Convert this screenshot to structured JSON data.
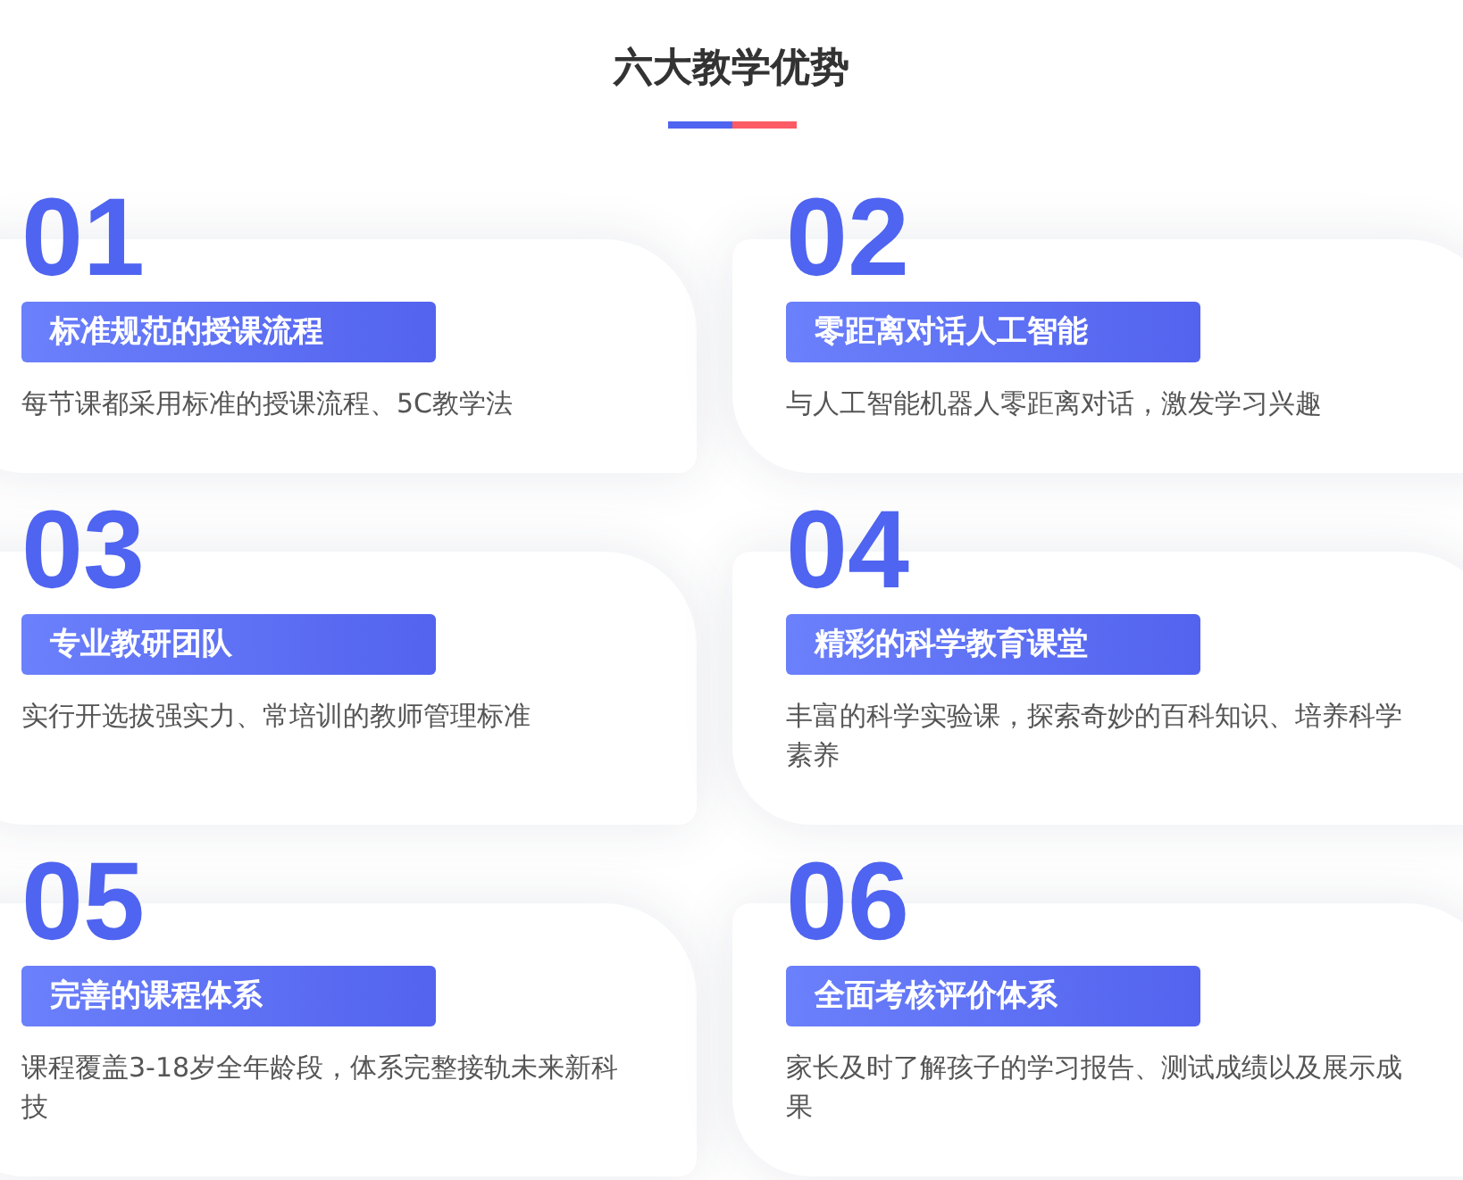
{
  "title": "六大教学优势",
  "features": [
    {
      "number": "01",
      "heading": "标准规范的授课流程",
      "description": "每节课都采用标准的授课流程、5C教学法"
    },
    {
      "number": "02",
      "heading": "零距离对话人工智能",
      "description": "与人工智能机器人零距离对话，激发学习兴趣"
    },
    {
      "number": "03",
      "heading": "专业教研团队",
      "description": "实行开选拔强实力、常培训的教师管理标准"
    },
    {
      "number": "04",
      "heading": "精彩的科学教育课堂",
      "description": "丰富的科学实验课，探索奇妙的百科知识、培养科学素养"
    },
    {
      "number": "05",
      "heading": "完善的课程体系",
      "description": "课程覆盖3-18岁全年龄段，体系完整接轨未来新科技"
    },
    {
      "number": "06",
      "heading": "全面考核评价体系",
      "description": "家长及时了解孩子的学习报告、测试成绩以及展示成果"
    }
  ]
}
